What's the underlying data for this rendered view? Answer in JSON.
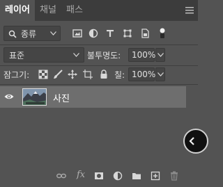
{
  "tabs": [
    {
      "label": "레이어",
      "active": true
    },
    {
      "label": "채널",
      "active": false
    },
    {
      "label": "패스",
      "active": false
    }
  ],
  "filter": {
    "kind_label": "종류"
  },
  "filter_icons": [
    "image-filter-icon",
    "adjustment-filter-icon",
    "type-filter-icon",
    "shape-filter-icon",
    "smart-object-filter-icon",
    "filter-toggle-icon"
  ],
  "blend_mode": {
    "value": "표준"
  },
  "opacity": {
    "label": "불투명도:",
    "value": "100%"
  },
  "lock": {
    "label": "잠그기:"
  },
  "fill": {
    "label": "칠:",
    "value": "100%"
  },
  "layers": [
    {
      "name": "사진",
      "visible": true,
      "selected": true
    }
  ],
  "bottom_icons": [
    "link-layers-icon",
    "fx-icon",
    "mask-icon",
    "adjustment-layer-icon",
    "group-folder-icon",
    "new-layer-icon",
    "trash-icon"
  ],
  "fx_label": "fx",
  "colors": {
    "panel": "#535353",
    "tabbar": "#3c3c3c",
    "selected_layer": "#6e6e6e",
    "field": "#454545"
  }
}
